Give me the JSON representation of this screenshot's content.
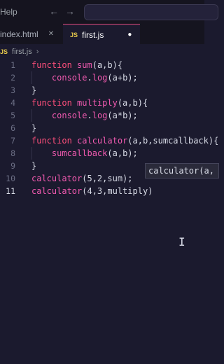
{
  "menu": {
    "help": "Help"
  },
  "nav": {
    "back": "←",
    "forward": "→"
  },
  "tabs": [
    {
      "label": "index.html",
      "close": "✕",
      "active": false
    },
    {
      "label": "first.js",
      "close": "●",
      "active": true
    }
  ],
  "breadcrumb": {
    "file": "first.js",
    "chevron": "›",
    "badge": "JS"
  },
  "code_lines": [
    {
      "n": "1",
      "parts": [
        [
          "kw",
          "function "
        ],
        [
          "fn",
          "sum"
        ],
        [
          "pl",
          "(a,b){"
        ]
      ]
    },
    {
      "n": "2",
      "parts": [
        [
          "pl",
          "    "
        ],
        [
          "fn",
          "console"
        ],
        [
          "pl",
          "."
        ],
        [
          "fn",
          "log"
        ],
        [
          "pl",
          "(a+b);"
        ]
      ]
    },
    {
      "n": "3",
      "parts": [
        [
          "pl",
          "}"
        ]
      ]
    },
    {
      "n": "4",
      "parts": [
        [
          "kw",
          "function "
        ],
        [
          "fn",
          "multiply"
        ],
        [
          "pl",
          "(a,b){"
        ]
      ]
    },
    {
      "n": "5",
      "parts": [
        [
          "pl",
          "    "
        ],
        [
          "fn",
          "console"
        ],
        [
          "pl",
          "."
        ],
        [
          "fn",
          "log"
        ],
        [
          "pl",
          "(a*b);"
        ]
      ]
    },
    {
      "n": "6",
      "parts": [
        [
          "pl",
          "}"
        ]
      ]
    },
    {
      "n": "7",
      "parts": [
        [
          "kw",
          "function "
        ],
        [
          "fn",
          "calculator"
        ],
        [
          "pl",
          "(a,b,sumcallback){"
        ]
      ]
    },
    {
      "n": "8",
      "parts": [
        [
          "pl",
          "    "
        ],
        [
          "fn",
          "sumcallback"
        ],
        [
          "pl",
          "(a,b);"
        ]
      ]
    },
    {
      "n": "9",
      "parts": [
        [
          "pl",
          "}"
        ]
      ]
    },
    {
      "n": "10",
      "parts": [
        [
          "fn",
          "calculator"
        ],
        [
          "pl",
          "(5,2,sum);"
        ]
      ]
    },
    {
      "n": "11",
      "parts": [
        [
          "fn",
          "calculator"
        ],
        [
          "pl",
          "(4,3,multiply)"
        ]
      ]
    }
  ],
  "active_line": "11",
  "hint": {
    "text": "calculator(a, b, sumcallback)"
  },
  "cursor_glyph": "I"
}
